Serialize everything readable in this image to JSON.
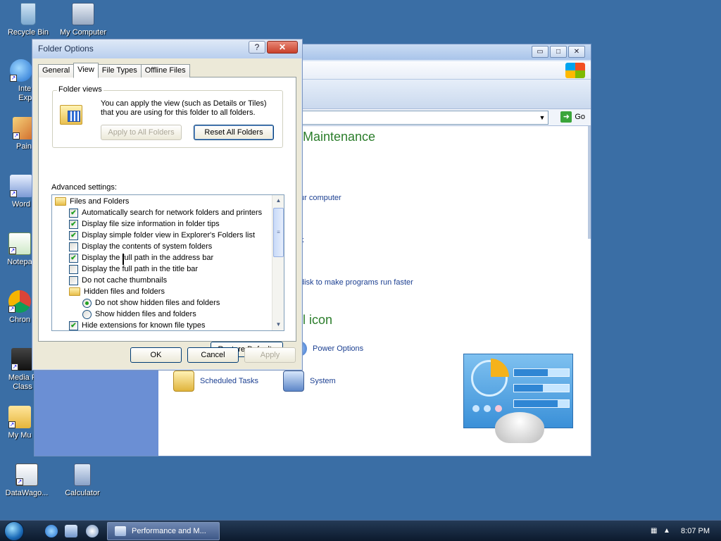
{
  "desktop": {
    "icons": [
      {
        "label": "Recycle Bin",
        "icon": "recycle-bin-icon"
      },
      {
        "label": "My Computer",
        "icon": "my-computer-icon"
      },
      {
        "label": "Intern Explo",
        "icon": "internet-explorer-icon"
      },
      {
        "label": "Pain",
        "icon": "paint-icon"
      },
      {
        "label": "Word",
        "icon": "word-icon"
      },
      {
        "label": "Notepa",
        "icon": "notepad-icon"
      },
      {
        "label": "Chron",
        "icon": "chrome-icon"
      },
      {
        "label": "Media P Class",
        "icon": "media-player-icon"
      },
      {
        "label": "My Mu",
        "icon": "my-music-icon"
      },
      {
        "label": "DataWago...",
        "icon": "datawagon-icon"
      },
      {
        "label": "Calculator",
        "icon": "calculator-icon"
      }
    ]
  },
  "back_window": {
    "go_label": "Go",
    "heading_maintenance": "Maintenance",
    "heading_control": "el icon",
    "links": [
      "ur computer",
      "k",
      "disk to make programs run faster"
    ],
    "items": [
      {
        "label": "Power Options",
        "icon": "power-options-icon"
      },
      {
        "label": "Scheduled Tasks",
        "icon": "scheduled-tasks-icon"
      },
      {
        "label": "System",
        "icon": "system-icon"
      }
    ],
    "buttons": {
      "minimize": "▭",
      "maximize": "□",
      "close": "✕"
    }
  },
  "dialog": {
    "title": "Folder Options",
    "help_label": "?",
    "close_label": "✕",
    "tabs": [
      {
        "label": "General",
        "active": false
      },
      {
        "label": "View",
        "active": true
      },
      {
        "label": "File Types",
        "active": false
      },
      {
        "label": "Offline Files",
        "active": false
      }
    ],
    "folder_views": {
      "label": "Folder views",
      "description": "You can apply the view (such as Details or Tiles) that you are using for this folder to all folders.",
      "apply_all": "Apply to All Folders",
      "reset_all": "Reset All Folders"
    },
    "advanced_label": "Advanced settings:",
    "settings": [
      {
        "type": "folder",
        "label": "Files and Folders",
        "indent": 0
      },
      {
        "type": "checkbox",
        "label": "Automatically search for network folders and printers",
        "checked": true,
        "indent": 1
      },
      {
        "type": "checkbox",
        "label": "Display file size information in folder tips",
        "checked": true,
        "indent": 1
      },
      {
        "type": "checkbox",
        "label": "Display simple folder view in Explorer's Folders list",
        "checked": true,
        "indent": 1
      },
      {
        "type": "checkbox",
        "label": "Display the contents of system folders",
        "checked": false,
        "indent": 1
      },
      {
        "type": "checkbox",
        "label": "Display the full path in the address bar",
        "checked": true,
        "indent": 1
      },
      {
        "type": "checkbox",
        "label": "Display the full path in the title bar",
        "checked": false,
        "indent": 1
      },
      {
        "type": "checkbox",
        "label": "Do not cache thumbnails",
        "checked": false,
        "indent": 1
      },
      {
        "type": "folder",
        "label": "Hidden files and folders",
        "indent": 1
      },
      {
        "type": "radio",
        "label": "Do not show hidden files and folders",
        "checked": true,
        "indent": 2
      },
      {
        "type": "radio",
        "label": "Show hidden files and folders",
        "checked": false,
        "indent": 2
      },
      {
        "type": "checkbox",
        "label": "Hide extensions for known file types",
        "checked": true,
        "indent": 1
      }
    ],
    "scroll": {
      "up": "▲",
      "down": "▼",
      "grip": "≡"
    },
    "restore_defaults": "Restore Defaults",
    "ok": "OK",
    "cancel": "Cancel",
    "apply": "Apply"
  },
  "taskbar": {
    "task_label": "Performance and M...",
    "tray_icons": [
      "▦",
      "▲"
    ],
    "clock": "8:07 PM"
  }
}
